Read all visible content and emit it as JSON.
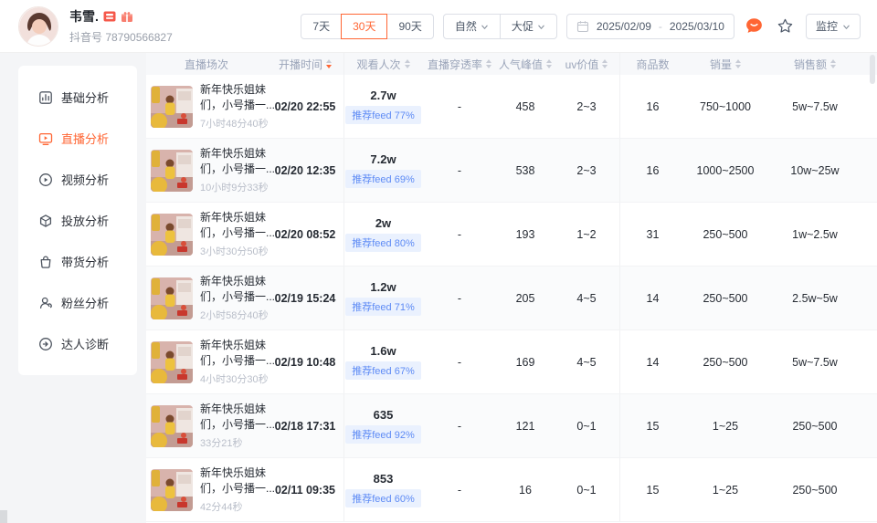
{
  "colors": {
    "accent": "#ff6634",
    "badge_text": "#5e8bf5",
    "badge_bg": "#eaf1fe"
  },
  "header": {
    "name": "韦雪.",
    "account": "抖音号 78790566827",
    "range_buttons": [
      {
        "label": "7天",
        "active": false
      },
      {
        "label": "30天",
        "active": true
      },
      {
        "label": "90天",
        "active": false
      }
    ],
    "dropdown_buttons": [
      {
        "label": "自然"
      },
      {
        "label": "大促"
      }
    ],
    "date_start": "2025/02/09",
    "date_separator": "-",
    "date_end": "2025/03/10",
    "monitor_label": "监控"
  },
  "sidebar": {
    "items": [
      {
        "key": "basic",
        "label": "基础分析",
        "active": false
      },
      {
        "key": "live",
        "label": "直播分析",
        "active": true
      },
      {
        "key": "video",
        "label": "视频分析",
        "active": false
      },
      {
        "key": "ads",
        "label": "投放分析",
        "active": false
      },
      {
        "key": "goods",
        "label": "带货分析",
        "active": false
      },
      {
        "key": "fans",
        "label": "粉丝分析",
        "active": false
      },
      {
        "key": "diagnosis",
        "label": "达人诊断",
        "active": false
      }
    ]
  },
  "table": {
    "columns": [
      {
        "key": "session",
        "label": "直播场次",
        "sortable": false
      },
      {
        "key": "start_time",
        "label": "开播时间",
        "sortable": true,
        "sorted": "desc"
      },
      {
        "key": "views",
        "label": "观看人次",
        "sortable": true
      },
      {
        "key": "penetration",
        "label": "直播穿透率",
        "sortable": true
      },
      {
        "key": "peak",
        "label": "人气峰值",
        "sortable": true
      },
      {
        "key": "uv",
        "label": "uv价值",
        "sortable": true
      },
      {
        "key": "products",
        "label": "商品数",
        "sortable": false
      },
      {
        "key": "sales",
        "label": "销量",
        "sortable": true
      },
      {
        "key": "gmv",
        "label": "销售额",
        "sortable": true
      }
    ],
    "rows": [
      {
        "title": "新年快乐姐妹们，小号播一...",
        "duration": "7小时48分40秒",
        "start_time": "02/20 22:55",
        "views": "2.7w",
        "feed_badge": "推荐feed 77%",
        "penetration": "-",
        "peak": "458",
        "uv": "2~3",
        "products": "16",
        "sales": "750~1000",
        "gmv": "5w~7.5w"
      },
      {
        "title": "新年快乐姐妹们，小号播一...",
        "duration": "10小时9分33秒",
        "start_time": "02/20 12:35",
        "views": "7.2w",
        "feed_badge": "推荐feed 69%",
        "penetration": "-",
        "peak": "538",
        "uv": "2~3",
        "products": "16",
        "sales": "1000~2500",
        "gmv": "10w~25w"
      },
      {
        "title": "新年快乐姐妹们，小号播一...",
        "duration": "3小时30分50秒",
        "start_time": "02/20 08:52",
        "views": "2w",
        "feed_badge": "推荐feed 80%",
        "penetration": "-",
        "peak": "193",
        "uv": "1~2",
        "products": "31",
        "sales": "250~500",
        "gmv": "1w~2.5w"
      },
      {
        "title": "新年快乐姐妹们，小号播一...",
        "duration": "2小时58分40秒",
        "start_time": "02/19 15:24",
        "views": "1.2w",
        "feed_badge": "推荐feed 71%",
        "penetration": "-",
        "peak": "205",
        "uv": "4~5",
        "products": "14",
        "sales": "250~500",
        "gmv": "2.5w~5w"
      },
      {
        "title": "新年快乐姐妹们，小号播一...",
        "duration": "4小时30分30秒",
        "start_time": "02/19 10:48",
        "views": "1.6w",
        "feed_badge": "推荐feed 67%",
        "penetration": "-",
        "peak": "169",
        "uv": "4~5",
        "products": "14",
        "sales": "250~500",
        "gmv": "5w~7.5w"
      },
      {
        "title": "新年快乐姐妹们，小号播一...",
        "duration": "33分21秒",
        "start_time": "02/18 17:31",
        "views": "635",
        "feed_badge": "推荐feed 92%",
        "penetration": "-",
        "peak": "121",
        "uv": "0~1",
        "products": "15",
        "sales": "1~25",
        "gmv": "250~500"
      },
      {
        "title": "新年快乐姐妹们，小号播一...",
        "duration": "42分44秒",
        "start_time": "02/11 09:35",
        "views": "853",
        "feed_badge": "推荐feed 60%",
        "penetration": "-",
        "peak": "16",
        "uv": "0~1",
        "products": "15",
        "sales": "1~25",
        "gmv": "250~500"
      }
    ]
  }
}
